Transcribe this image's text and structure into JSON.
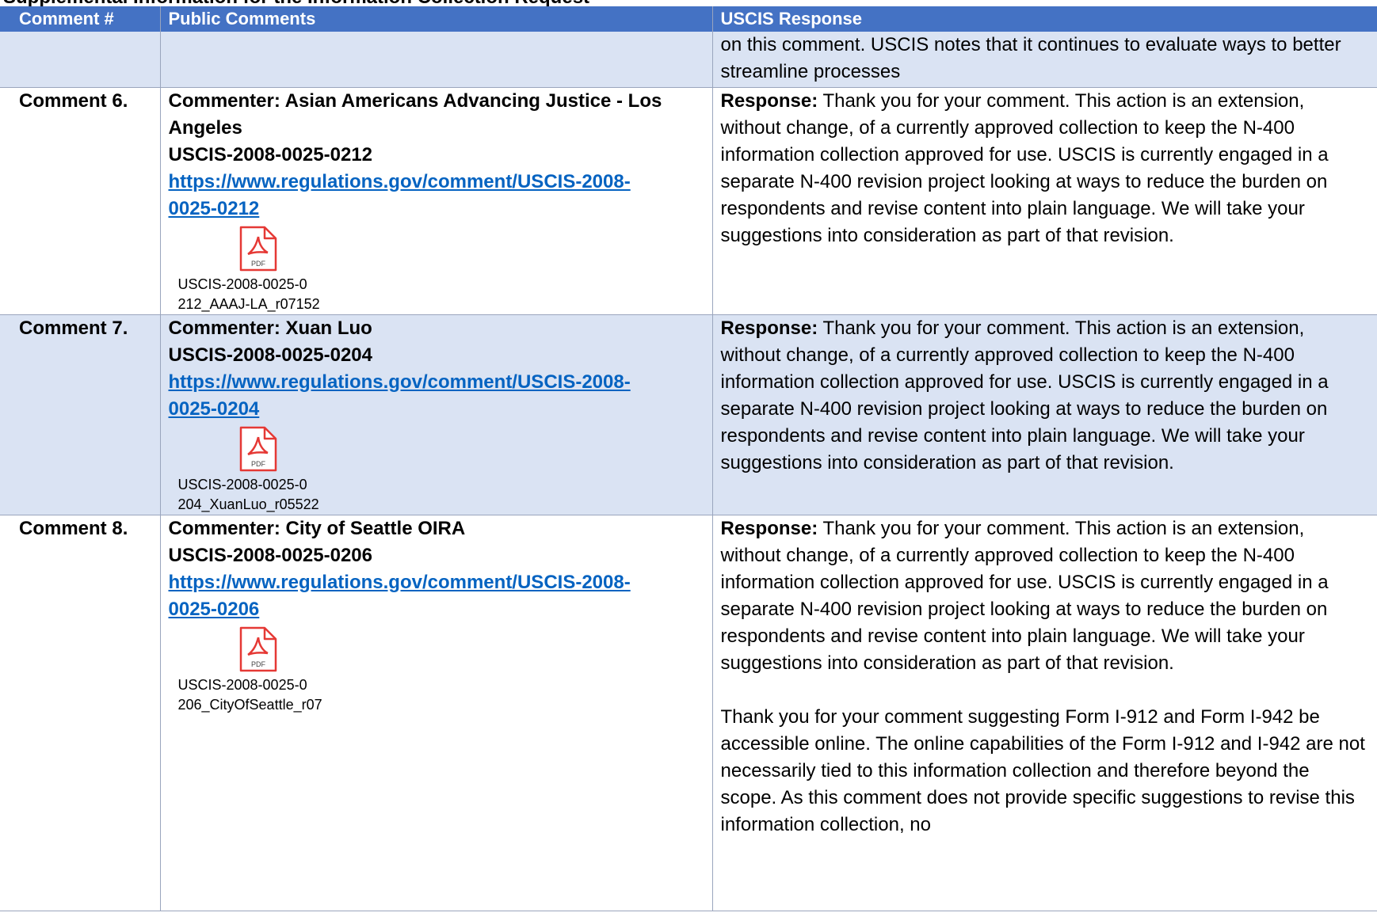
{
  "top_strip_text": "Supplemental Information for the Information Collection Request",
  "headers": {
    "col1": "Comment #",
    "col2": "Public Comments",
    "col3": "USCIS Response"
  },
  "carryover_row": {
    "response": "on this comment.  USCIS notes that it continues to evaluate ways to better streamline processes"
  },
  "rows": [
    {
      "number": "Comment 6.",
      "commenter": "Commenter: Asian Americans Advancing Justice - Los Angeles",
      "doc_id": "USCIS-2008-0025-0212",
      "link_line1": "https://www.regulations.gov/comment/USCIS-2008-",
      "link_line2": "0025-0212",
      "attachment_line1": "USCIS-2008-0025-0",
      "attachment_line2": "212_AAAJ-LA_r07152",
      "response_label": "Response:",
      "response_text": " Thank you for your comment.  This action is an extension, without change, of a currently approved collection to keep the N-400 information collection approved for use.  USCIS is currently engaged in a separate N-400 revision project looking at ways to reduce the burden on respondents and revise content into plain language.  We will take your suggestions into consideration as part of that revision.",
      "extra_response": ""
    },
    {
      "number": "Comment 7.",
      "commenter": "Commenter: Xuan Luo",
      "doc_id": "USCIS-2008-0025-0204",
      "link_line1": "https://www.regulations.gov/comment/USCIS-2008-",
      "link_line2": "0025-0204",
      "attachment_line1": "USCIS-2008-0025-0",
      "attachment_line2": "204_XuanLuo_r05522",
      "response_label": "Response:",
      "response_text": " Thank you for your comment.  This action is an extension, without change, of a currently approved collection to keep the N-400 information collection approved for use.  USCIS is currently engaged in a separate N-400 revision project looking at ways to reduce the burden on respondents and revise content into plain language.  We will take your suggestions into consideration as part of that revision.",
      "extra_response": ""
    },
    {
      "number": "Comment 8.",
      "commenter": "Commenter: City of Seattle OIRA",
      "doc_id": "USCIS-2008-0025-0206",
      "link_line1": "https://www.regulations.gov/comment/USCIS-2008-",
      "link_line2": "0025-0206",
      "attachment_line1": "USCIS-2008-0025-0",
      "attachment_line2": "206_CityOfSeattle_r07",
      "response_label": "Response:",
      "response_text": " Thank you for your comment.  This action is an extension, without change, of a currently approved collection to keep the N-400 information collection approved for use.  USCIS is currently engaged in a separate N-400 revision project looking at ways to reduce the burden on respondents and revise content into plain language.  We will take your suggestions into consideration as part of that revision.",
      "extra_response": "Thank you for your comment suggesting Form I-912 and Form I-942 be accessible online.  The online capabilities of the Form I-912 and I-942 are not necessarily tied to this information collection and therefore beyond the scope.  As this comment does not provide specific suggestions to revise this information collection, no"
    }
  ],
  "colors": {
    "header_bg": "#4472c4",
    "shaded_row_bg": "#dae3f3",
    "link": "#0563c1",
    "pdf_icon": "#e53935"
  },
  "attachment_icon": "pdf-file-icon",
  "pdf_icon_text": "PDF"
}
